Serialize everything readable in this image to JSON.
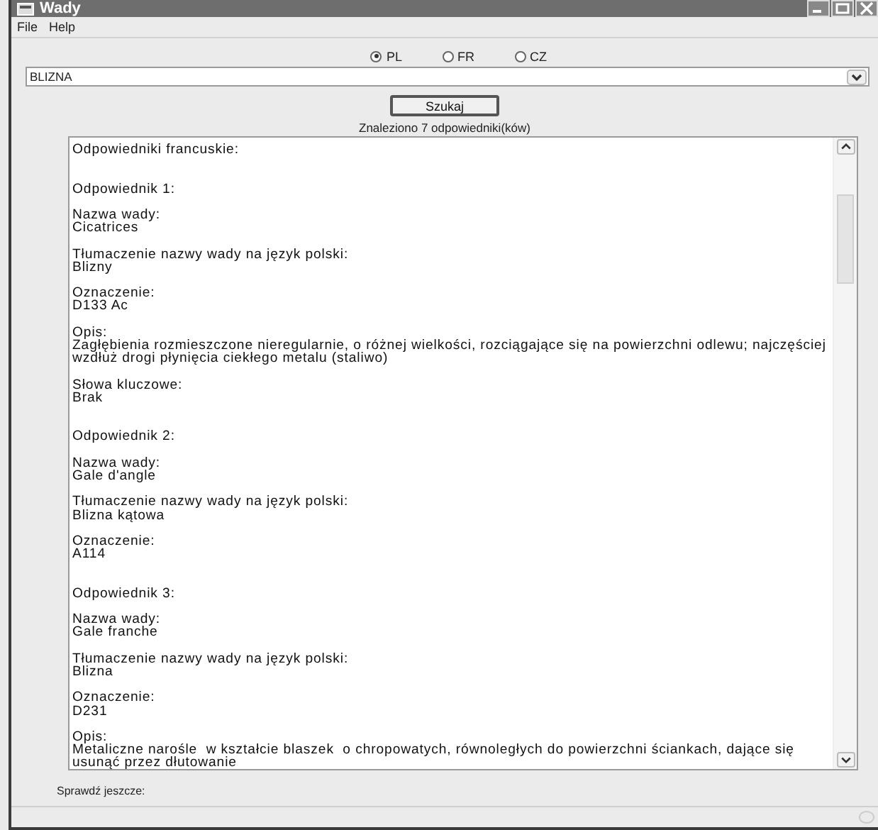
{
  "window": {
    "title": "Wady"
  },
  "menu": [
    "File",
    "Help"
  ],
  "languages": [
    {
      "label": "PL",
      "selected": true
    },
    {
      "label": "FR",
      "selected": false
    },
    {
      "label": "CZ",
      "selected": false
    }
  ],
  "search": {
    "value": "BLIZNA"
  },
  "search_button": "Szukaj",
  "result_count": "Znaleziono 7 odpowiedniki(ków)",
  "results": {
    "heading": "Odpowiedniki francuskie:",
    "entries": [
      {
        "heading": "Odpowiednik 1:",
        "fields": [
          {
            "label": "Nazwa wady:",
            "value": "Cicatrices"
          },
          {
            "label": "Tłumaczenie nazwy wady na język polski:",
            "value": "Blizny"
          },
          {
            "label": "Oznaczenie:",
            "value": "D133 Ac"
          },
          {
            "label": "Opis:",
            "value": "Zagłębienia rozmieszczone nieregularnie, o różnej wielkości, rozciągające się na powierzchni odlewu; najczęściej wzdłuż drogi płynięcia ciekłego metalu (staliwo)"
          },
          {
            "label": "Słowa kluczowe:",
            "value": "Brak"
          }
        ]
      },
      {
        "heading": "Odpowiednik 2:",
        "fields": [
          {
            "label": "Nazwa wady:",
            "value": "Gale d'angle"
          },
          {
            "label": "Tłumaczenie nazwy wady na język polski:",
            "value": "Blizna kątowa"
          },
          {
            "label": "Oznaczenie:",
            "value": "A114"
          }
        ]
      },
      {
        "heading": "Odpowiednik 3:",
        "fields": [
          {
            "label": "Nazwa wady:",
            "value": "Gale franche"
          },
          {
            "label": "Tłumaczenie nazwy wady na język polski:",
            "value": "Blizna"
          },
          {
            "label": "Oznaczenie:",
            "value": "D231"
          },
          {
            "label": "Opis:",
            "value": "Metaliczne narośle  w kształcie blaszek  o chropowatych, równoległych do powierzchni ściankach, dające się usunąć przez dłutowanie"
          }
        ]
      }
    ]
  },
  "footer_label": "Sprawdź jeszcze:"
}
